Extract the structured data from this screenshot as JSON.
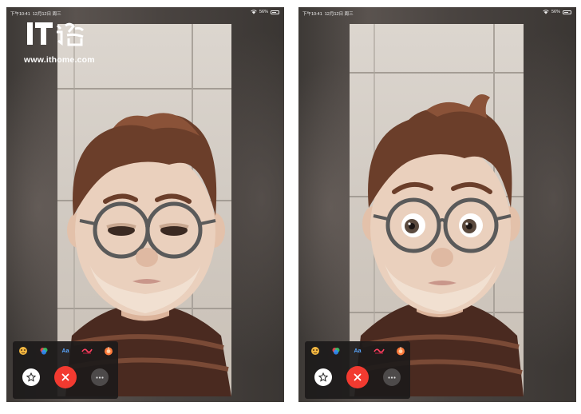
{
  "watermark": {
    "logo_text": "IT之家",
    "url": "www.ithome.com"
  },
  "screens": [
    {
      "status": {
        "time": "下午10:41",
        "date": "12月12日 周三",
        "battery": "56%"
      },
      "effects": [
        {
          "icon": "animoji-icon"
        },
        {
          "icon": "filters-icon"
        },
        {
          "label": "Aa",
          "icon": "text-icon"
        },
        {
          "icon": "shapes-icon"
        },
        {
          "icon": "stickers-icon"
        }
      ],
      "buttons": {
        "effects": "star-icon",
        "end": "close-icon",
        "more": "more-icon"
      },
      "memoji": "squinting"
    },
    {
      "status": {
        "time": "下午10:41",
        "date": "12月12日 周三",
        "battery": "56%"
      },
      "effects": [
        {
          "icon": "animoji-icon"
        },
        {
          "icon": "filters-icon"
        },
        {
          "label": "Aa",
          "icon": "text-icon"
        },
        {
          "icon": "shapes-icon"
        },
        {
          "icon": "stickers-icon"
        }
      ],
      "buttons": {
        "effects": "star-icon",
        "end": "close-icon",
        "more": "more-icon"
      },
      "memoji": "wide-eyed"
    }
  ],
  "colors": {
    "end_call": "#f23a30",
    "panel": "#1c1a1a",
    "hair": "#6b3e2a",
    "skin": "#e7c9b3",
    "sweater": "#4a2a20"
  }
}
